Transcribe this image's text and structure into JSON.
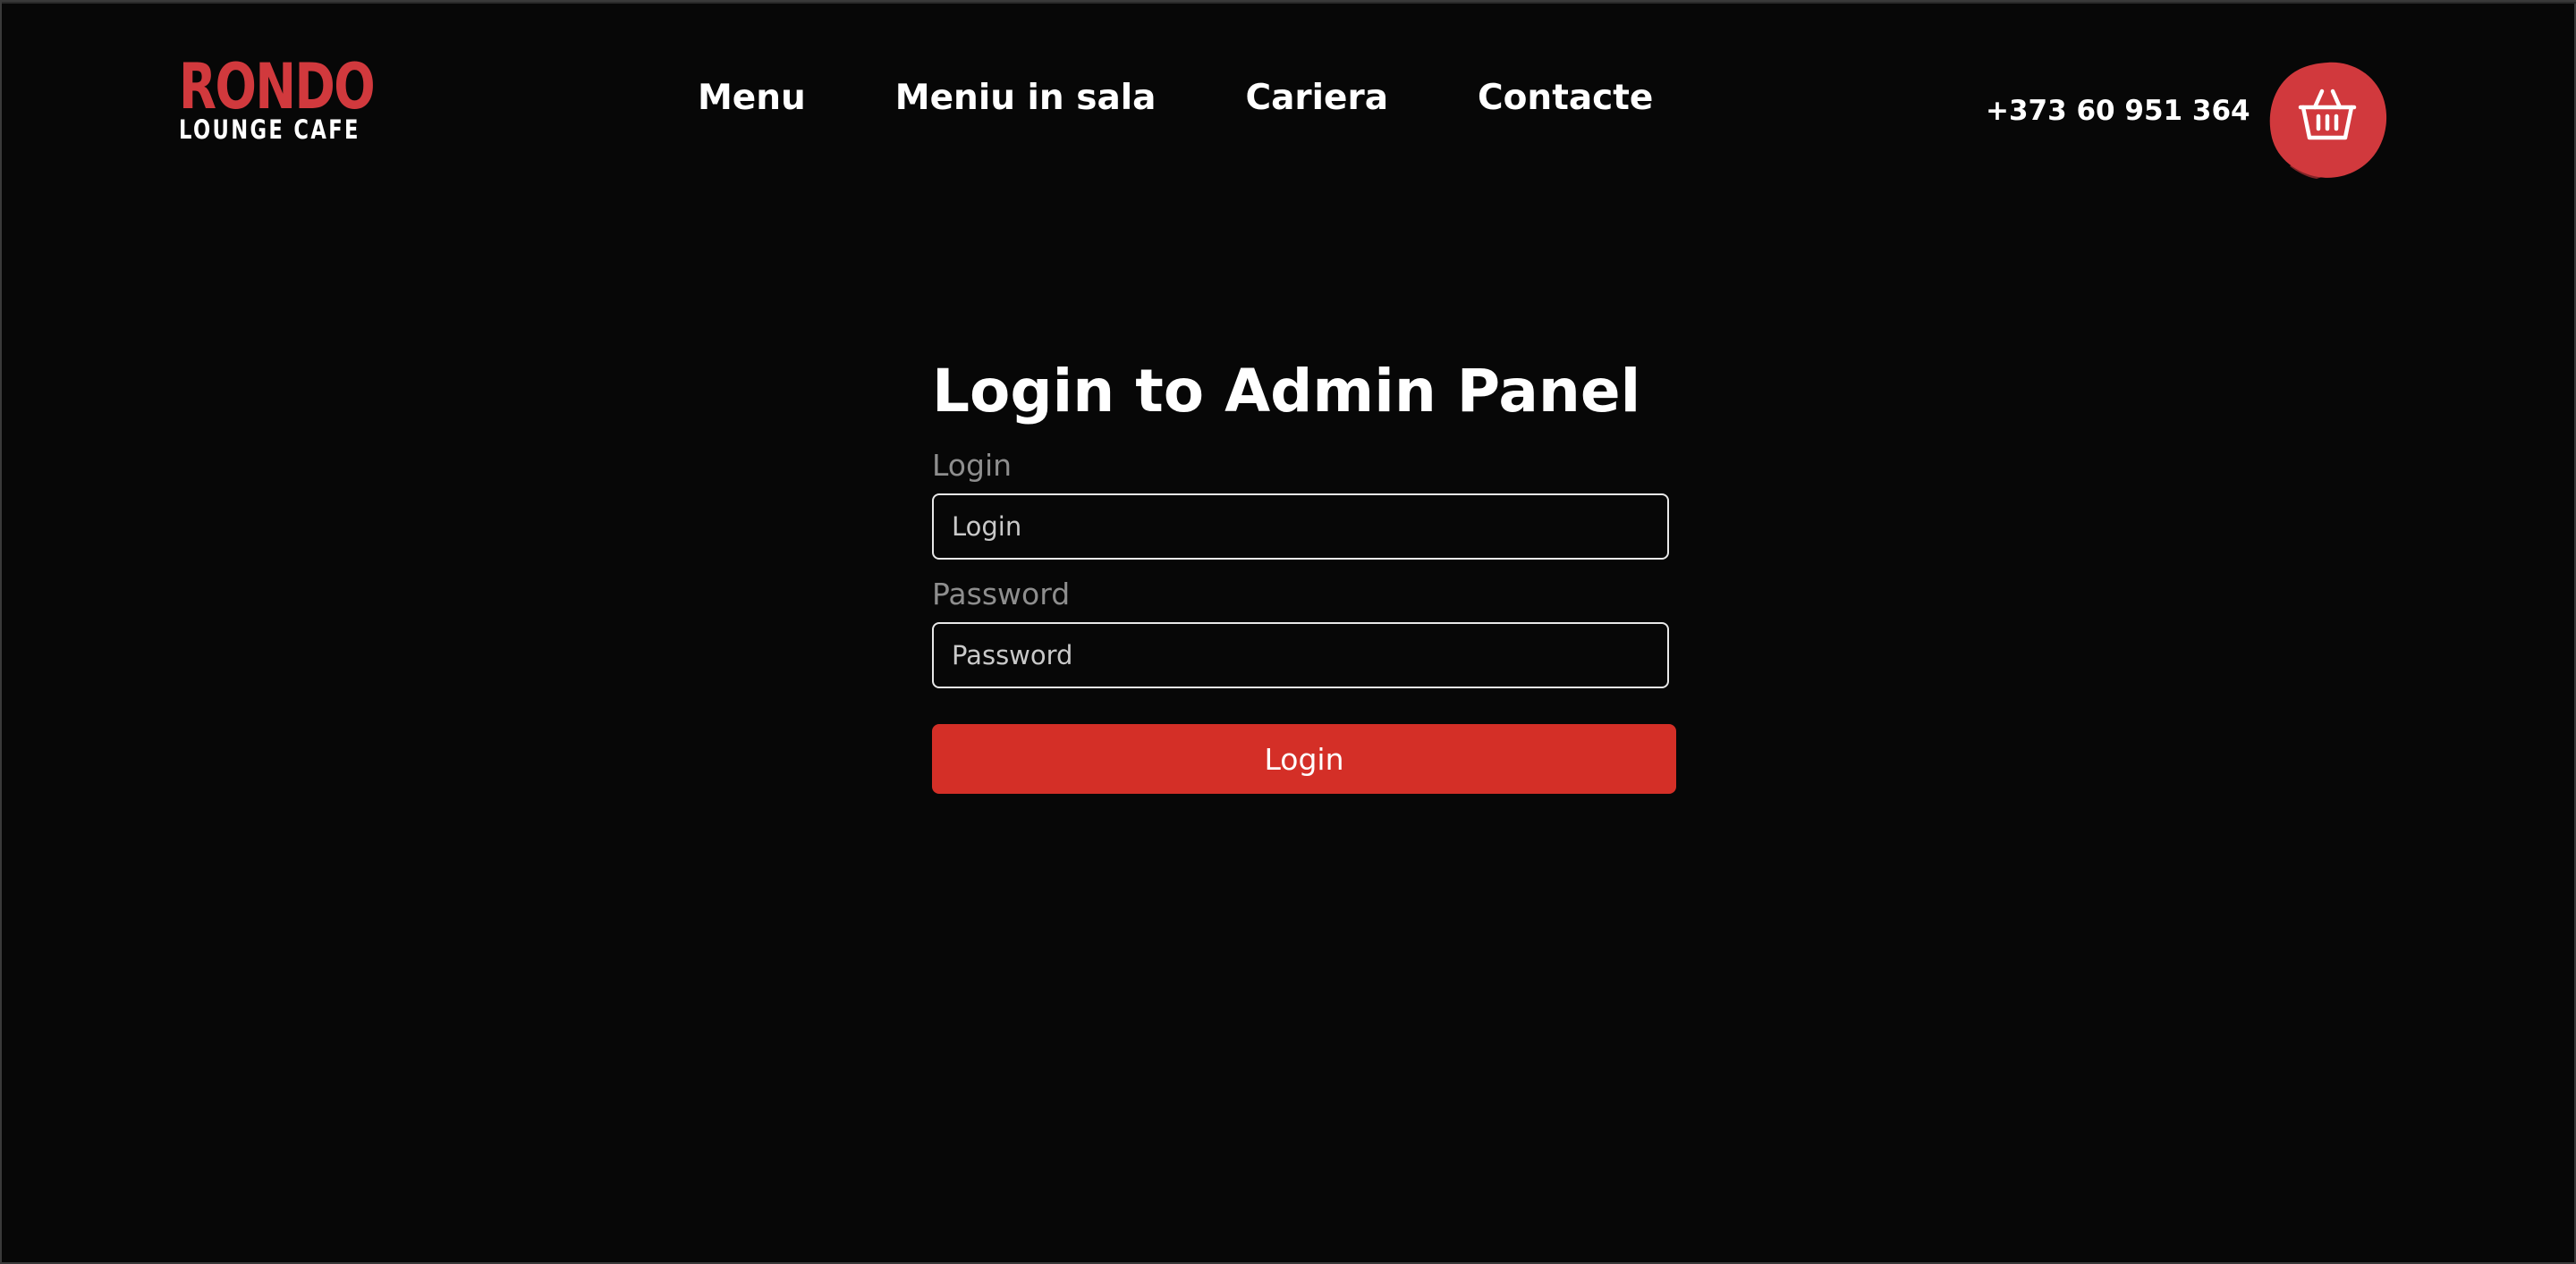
{
  "header": {
    "logo": {
      "main": "RONDO",
      "sub": "LOUNGE CAFE"
    },
    "nav": [
      {
        "label": "Menu"
      },
      {
        "label": "Meniu in sala"
      },
      {
        "label": "Cariera"
      },
      {
        "label": "Contacte"
      }
    ],
    "phone": "+373 60 951 364",
    "cart_icon": "basket-icon"
  },
  "login": {
    "title": "Login to Admin Panel",
    "login_label": "Login",
    "login_value": "",
    "login_placeholder": "Login",
    "password_label": "Password",
    "password_value": "",
    "password_placeholder": "Password",
    "submit_label": "Login"
  },
  "colors": {
    "background": "#070707",
    "accent": "#d42f27",
    "logo_red": "#d1393d",
    "label_gray": "#8e8e8e",
    "text": "#ffffff"
  }
}
